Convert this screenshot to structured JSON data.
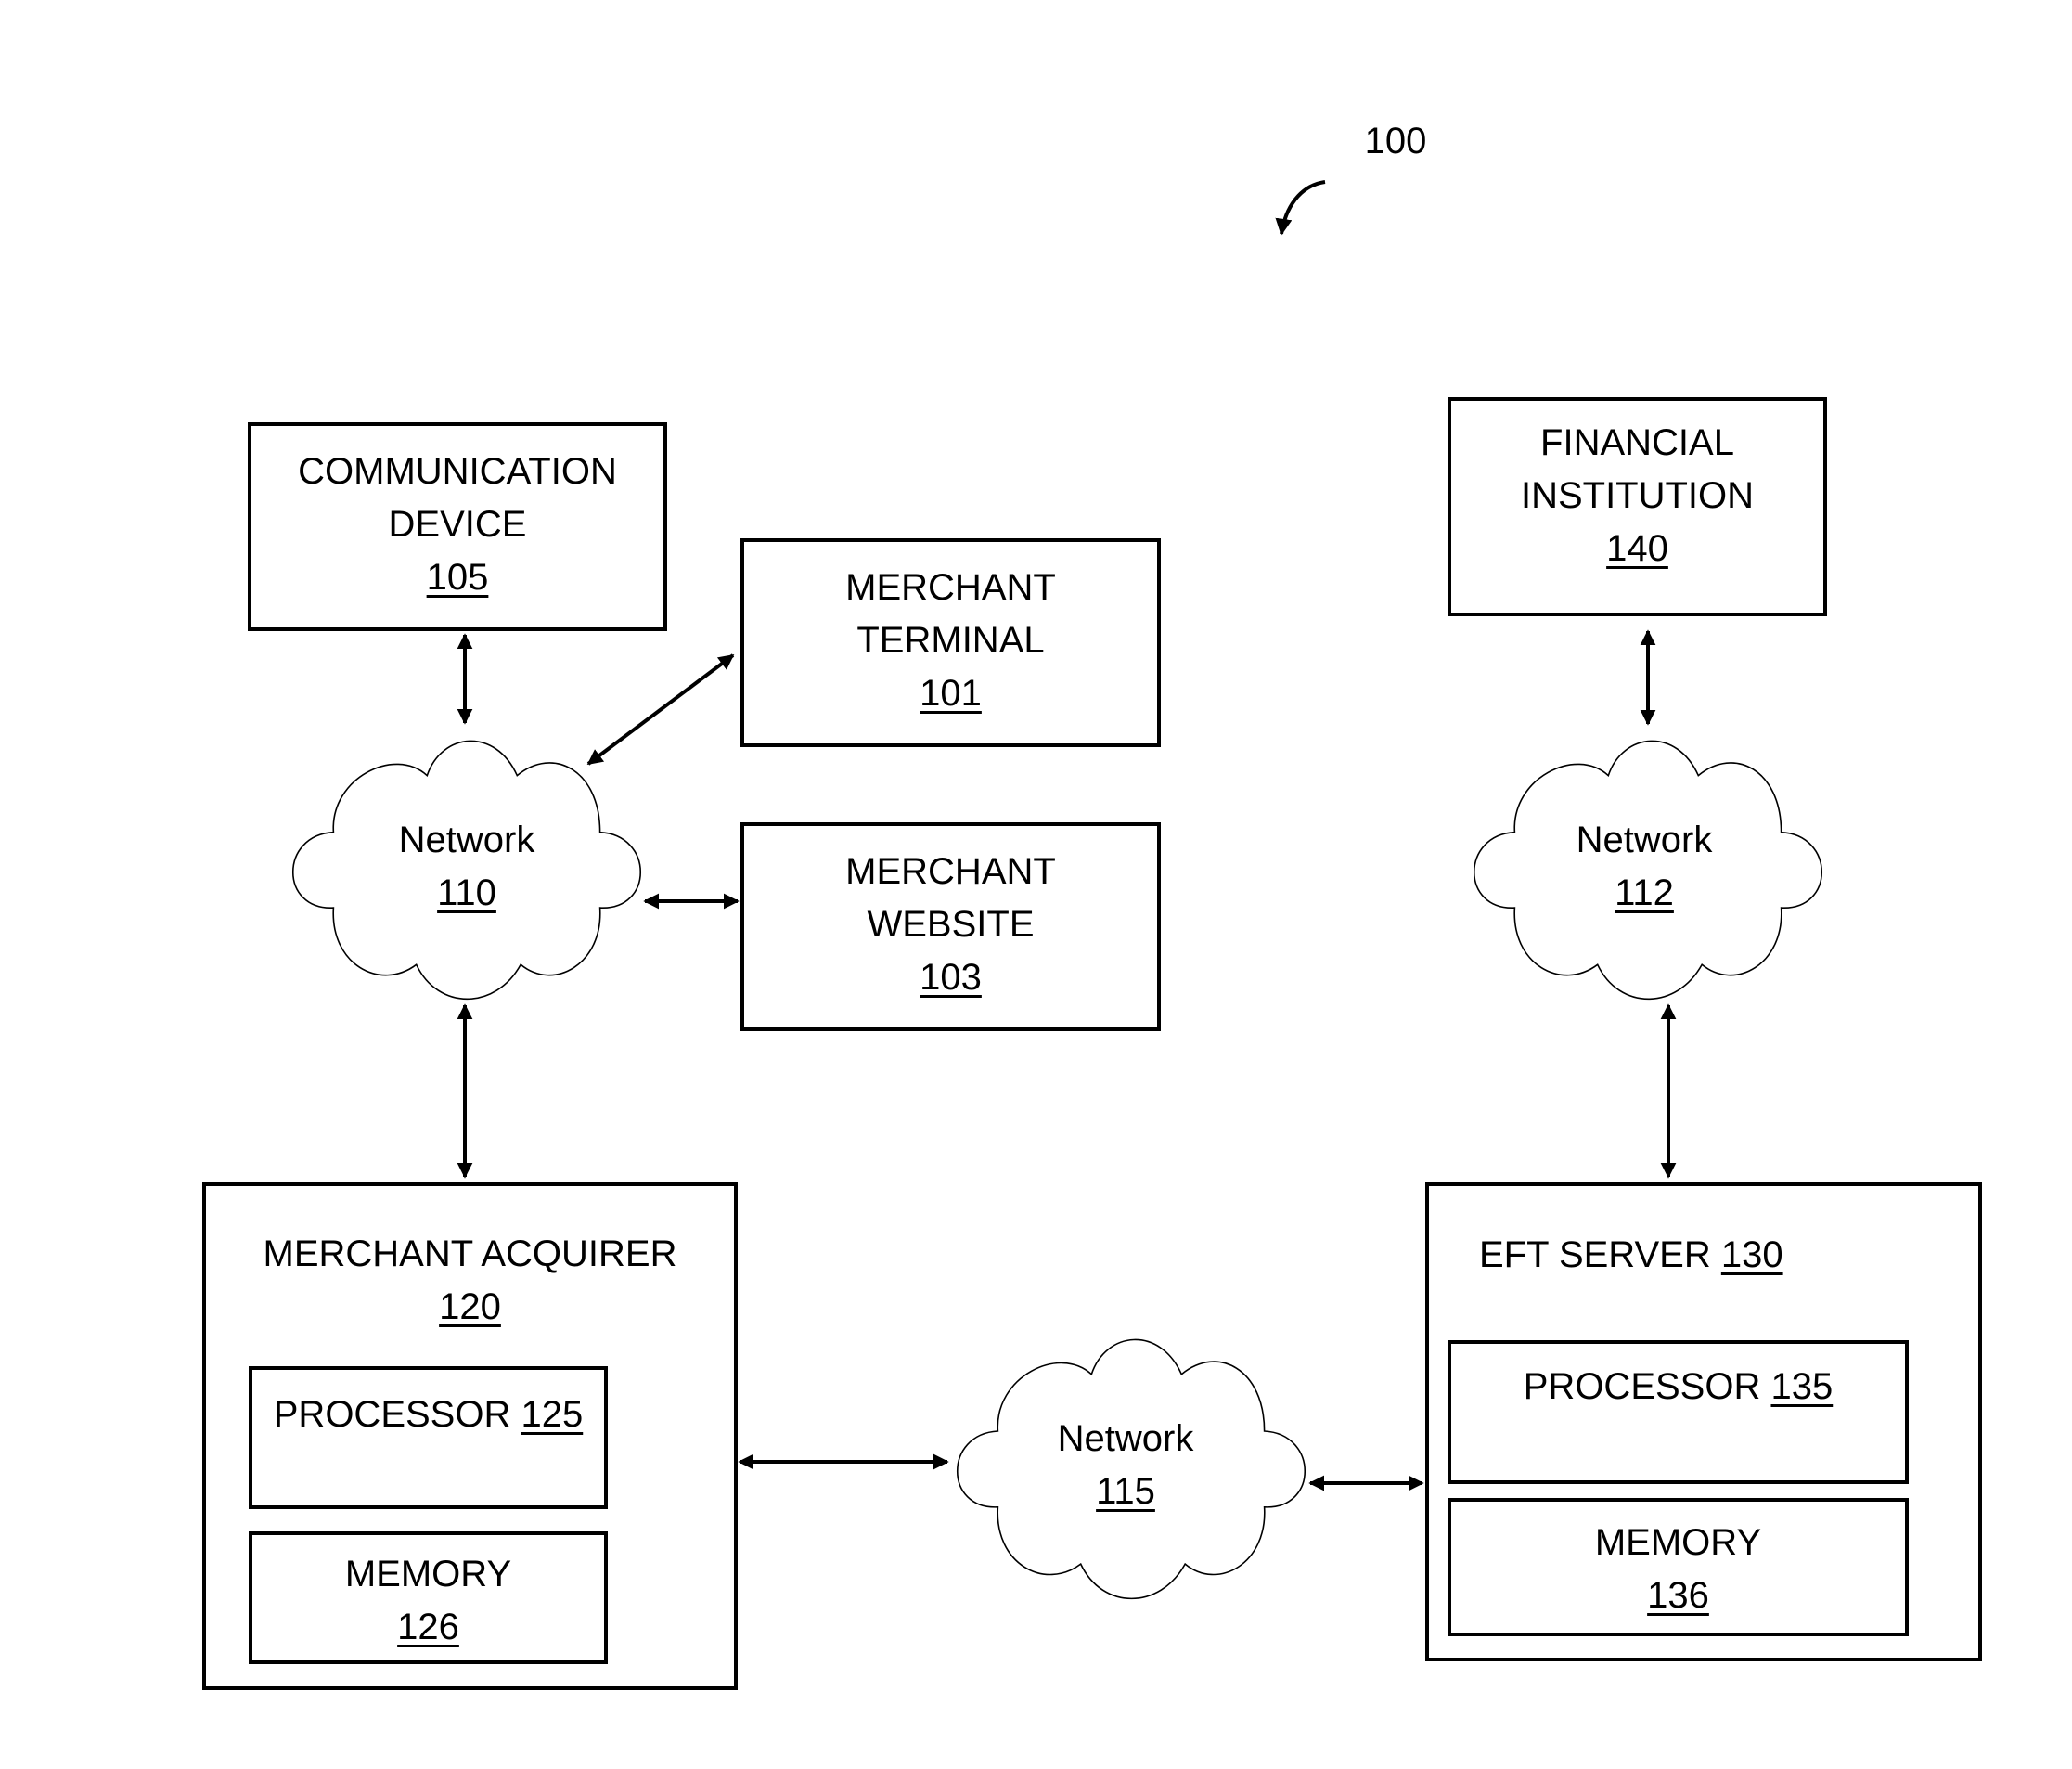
{
  "figure": {
    "reference_numeral": "100"
  },
  "nodes": {
    "communication_device": {
      "lines": [
        "COMMUNICATION",
        "DEVICE"
      ],
      "ref": "105"
    },
    "merchant_terminal": {
      "lines": [
        "MERCHANT",
        "TERMINAL"
      ],
      "ref": "101"
    },
    "merchant_website": {
      "lines": [
        "MERCHANT",
        "WEBSITE"
      ],
      "ref": "103"
    },
    "financial_institution": {
      "lines": [
        "FINANCIAL",
        "INSTITUTION"
      ],
      "ref": "140"
    },
    "network_110": {
      "label": "Network",
      "ref": "110"
    },
    "network_112": {
      "label": "Network",
      "ref": "112"
    },
    "network_115": {
      "label": "Network",
      "ref": "115"
    },
    "merchant_acquirer": {
      "label": "MERCHANT ACQUIRER",
      "ref": "120",
      "processor": {
        "label": "PROCESSOR",
        "ref": "125"
      },
      "memory": {
        "label": "MEMORY",
        "ref": "126"
      }
    },
    "eft_server": {
      "label": "EFT SERVER",
      "ref": "130",
      "processor": {
        "label": "PROCESSOR",
        "ref": "135"
      },
      "memory": {
        "label": "MEMORY",
        "ref": "136"
      }
    }
  },
  "connections": [
    {
      "from": "communication_device",
      "to": "network_110",
      "bidirectional": true
    },
    {
      "from": "merchant_terminal",
      "to": "network_110",
      "bidirectional": true
    },
    {
      "from": "merchant_website",
      "to": "network_110",
      "bidirectional": true
    },
    {
      "from": "network_110",
      "to": "merchant_acquirer",
      "bidirectional": true
    },
    {
      "from": "merchant_acquirer",
      "to": "network_115",
      "bidirectional": true
    },
    {
      "from": "network_115",
      "to": "eft_server",
      "bidirectional": true
    },
    {
      "from": "eft_server",
      "to": "network_112",
      "bidirectional": true
    },
    {
      "from": "network_112",
      "to": "financial_institution",
      "bidirectional": true
    }
  ]
}
